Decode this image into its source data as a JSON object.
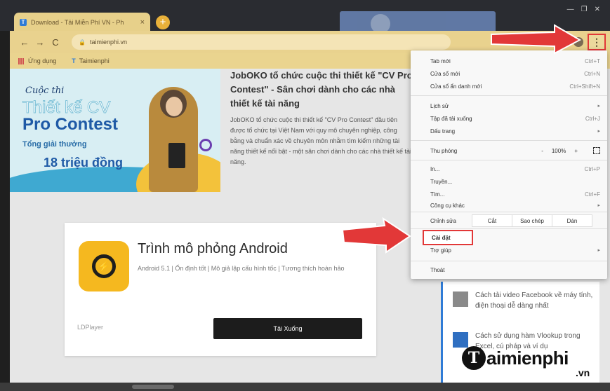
{
  "browser": {
    "tab_title": "Download - Tải Miễn Phí VN - Ph",
    "tab_favicon": "T",
    "tab_close": "×",
    "new_tab": "+",
    "window_controls": [
      "—",
      "❐",
      "✕"
    ],
    "nav": {
      "back": "←",
      "forward": "→",
      "reload": "C"
    },
    "address": "taimienphi.vn",
    "menu_button": "⋮"
  },
  "bookmarks": [
    {
      "label": "Ứng dụng",
      "icon": "apps-grid-icon"
    },
    {
      "label": "Taimienphi",
      "icon": "taimienphi-logo-icon"
    }
  ],
  "banner": {
    "line1": "Cuộc thi",
    "line2": "Thiết kế CV",
    "line3": "Pro Contest",
    "line4": "Tổng giải thưởng",
    "line5": "18 triệu đồng"
  },
  "article": {
    "heading": "JobOKO tổ chức cuộc thi thiết kế \"CV Pro Contest\" - Sân chơi dành cho các nhà thiết kế tài năng",
    "body": "JobOKO tổ chức cuộc thi thiết kế \"CV Pro Contest\" đầu tiên được tổ chức tại Việt Nam với quy mô chuyên nghiệp, công bằng và chuẩn xác về chuyên môn nhằm tìm kiếm những tài năng thiết kế nổi bật - một sân chơi dành cho các nhà thiết kế tài năng."
  },
  "app_card": {
    "name": "Trình mô phỏng Android",
    "description": "Android 5.1 | Ổn định tốt | Mô giả lập cấu hình tốc | Tương thích hoàn hảo",
    "vendor": "LDPlayer",
    "download": "Tải Xuống"
  },
  "side_list": [
    {
      "text": "Cách tải video Facebook về máy tính, điện thoại dễ dàng nhất",
      "thumb_color": "#8a8a8a"
    },
    {
      "text": "Cách sử dụng hàm Vlookup trong Excel, cú pháp và ví dụ",
      "thumb_color": "#2f6fc1"
    }
  ],
  "menu": {
    "new_tab": {
      "label": "Tab mới",
      "shortcut": "Ctrl+T"
    },
    "new_window": {
      "label": "Cửa sổ mới",
      "shortcut": "Ctrl+N"
    },
    "incognito": {
      "label": "Cửa sổ ẩn danh mới",
      "shortcut": "Ctrl+Shift+N"
    },
    "history": {
      "label": "Lịch sử",
      "arrow": "▸"
    },
    "downloads": {
      "label": "Tập đã tải xuống",
      "shortcut": "Ctrl+J"
    },
    "bookmarks": {
      "label": "Dấu trang",
      "arrow": "▸"
    },
    "zoom": {
      "label": "Thu phóng",
      "minus": "-",
      "value": "100%",
      "plus": "+"
    },
    "print": {
      "label": "In...",
      "shortcut": "Ctrl+P"
    },
    "cast": {
      "label": "Truyền..."
    },
    "find": {
      "label": "Tìm...",
      "shortcut": "Ctrl+F"
    },
    "more_tools": {
      "label": "Công cụ khác",
      "arrow": "▸"
    },
    "edit": {
      "label": "Chỉnh sửa",
      "cut": "Cắt",
      "copy": "Sao chép",
      "paste": "Dán"
    },
    "settings": {
      "label": "Cài đặt"
    },
    "help": {
      "label": "Trợ giúp",
      "arrow": "▸"
    },
    "exit": {
      "label": "Thoát"
    }
  },
  "watermark": {
    "logo_letter": "T",
    "name": "aimienphi",
    "tld": ".vn"
  },
  "colors": {
    "tab_bar": "#e9d28e",
    "annotation_red": "#e23838",
    "accent_blue": "#2f7bd6"
  }
}
